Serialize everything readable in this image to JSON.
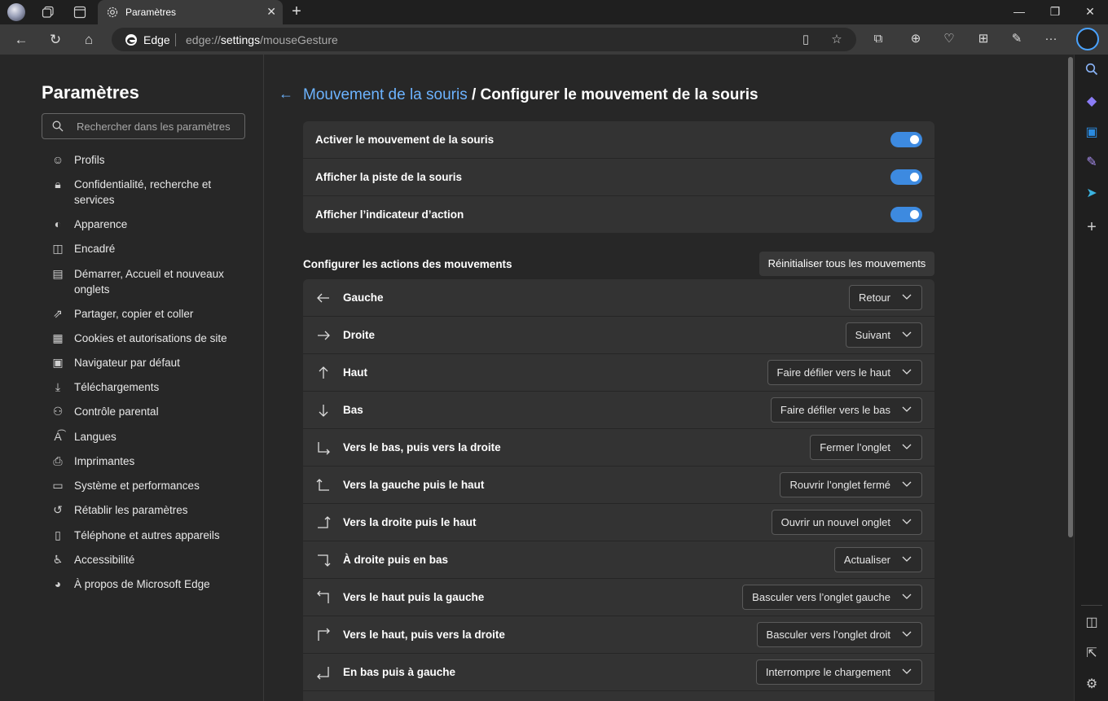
{
  "browser": {
    "tab_title": "Paramètres",
    "address_label": "Edge",
    "url_prefix": "edge://",
    "url_bold": "settings",
    "url_suffix": "/mouseGesture"
  },
  "sidebar": {
    "title": "Paramètres",
    "search_placeholder": "Rechercher dans les paramètres",
    "items": [
      {
        "label": "Profils",
        "icon": "profile-icon"
      },
      {
        "label": "Confidentialité, recherche et services",
        "icon": "lock-icon"
      },
      {
        "label": "Apparence",
        "icon": "palette-icon"
      },
      {
        "label": "Encadré",
        "icon": "sidebar-panel-icon"
      },
      {
        "label": "Démarrer, Accueil et nouveaux onglets",
        "icon": "home-tabs-icon"
      },
      {
        "label": "Partager, copier et coller",
        "icon": "share-icon"
      },
      {
        "label": "Cookies et autorisations de site",
        "icon": "cookies-icon"
      },
      {
        "label": "Navigateur par défaut",
        "icon": "default-browser-icon"
      },
      {
        "label": "Téléchargements",
        "icon": "download-icon"
      },
      {
        "label": "Contrôle parental",
        "icon": "family-icon"
      },
      {
        "label": "Langues",
        "icon": "language-icon"
      },
      {
        "label": "Imprimantes",
        "icon": "printer-icon"
      },
      {
        "label": "Système et performances",
        "icon": "laptop-icon"
      },
      {
        "label": "Rétablir les paramètres",
        "icon": "reset-icon"
      },
      {
        "label": "Téléphone et autres appareils",
        "icon": "phone-icon"
      },
      {
        "label": "Accessibilité",
        "icon": "accessibility-icon"
      },
      {
        "label": "À propos de Microsoft Edge",
        "icon": "edge-logo-icon"
      }
    ]
  },
  "main": {
    "breadcrumb_link": "Mouvement de la souris",
    "breadcrumb_current": " / Configurer le mouvement de la souris",
    "toggles": [
      {
        "label": "Activer le mouvement de la souris",
        "on": true
      },
      {
        "label": "Afficher la piste de la souris",
        "on": true
      },
      {
        "label": "Afficher l’indicateur d’action",
        "on": true
      }
    ],
    "section_title": "Configurer les actions des mouvements",
    "reset_label": "Réinitialiser tous les mouvements",
    "gestures": [
      {
        "label": "Gauche",
        "action": "Retour",
        "icon": "arrow-left-icon"
      },
      {
        "label": "Droite",
        "action": "Suivant",
        "icon": "arrow-right-icon"
      },
      {
        "label": "Haut",
        "action": "Faire défiler vers le haut",
        "icon": "arrow-up-icon"
      },
      {
        "label": "Bas",
        "action": "Faire défiler vers le bas",
        "icon": "arrow-down-icon"
      },
      {
        "label": "Vers le bas, puis vers la droite",
        "action": "Fermer l’onglet",
        "icon": "down-right-icon"
      },
      {
        "label": "Vers la gauche puis le haut",
        "action": "Rouvrir l’onglet fermé",
        "icon": "left-up-icon"
      },
      {
        "label": "Vers la droite puis le haut",
        "action": "Ouvrir un nouvel onglet",
        "icon": "right-up-icon"
      },
      {
        "label": "À droite puis en bas",
        "action": "Actualiser",
        "icon": "right-down-icon"
      },
      {
        "label": "Vers le haut puis la gauche",
        "action": "Basculer vers l’onglet gauche",
        "icon": "up-left-icon"
      },
      {
        "label": "Vers le haut, puis vers la droite",
        "action": "Basculer vers l’onglet droit",
        "icon": "up-right-icon"
      },
      {
        "label": "En bas puis à gauche",
        "action": "Interrompre le chargement",
        "icon": "down-left-icon"
      }
    ]
  },
  "colors": {
    "accent": "#3d8ae0",
    "link": "#6cb3ff",
    "background": "#272727",
    "card": "#333333"
  }
}
